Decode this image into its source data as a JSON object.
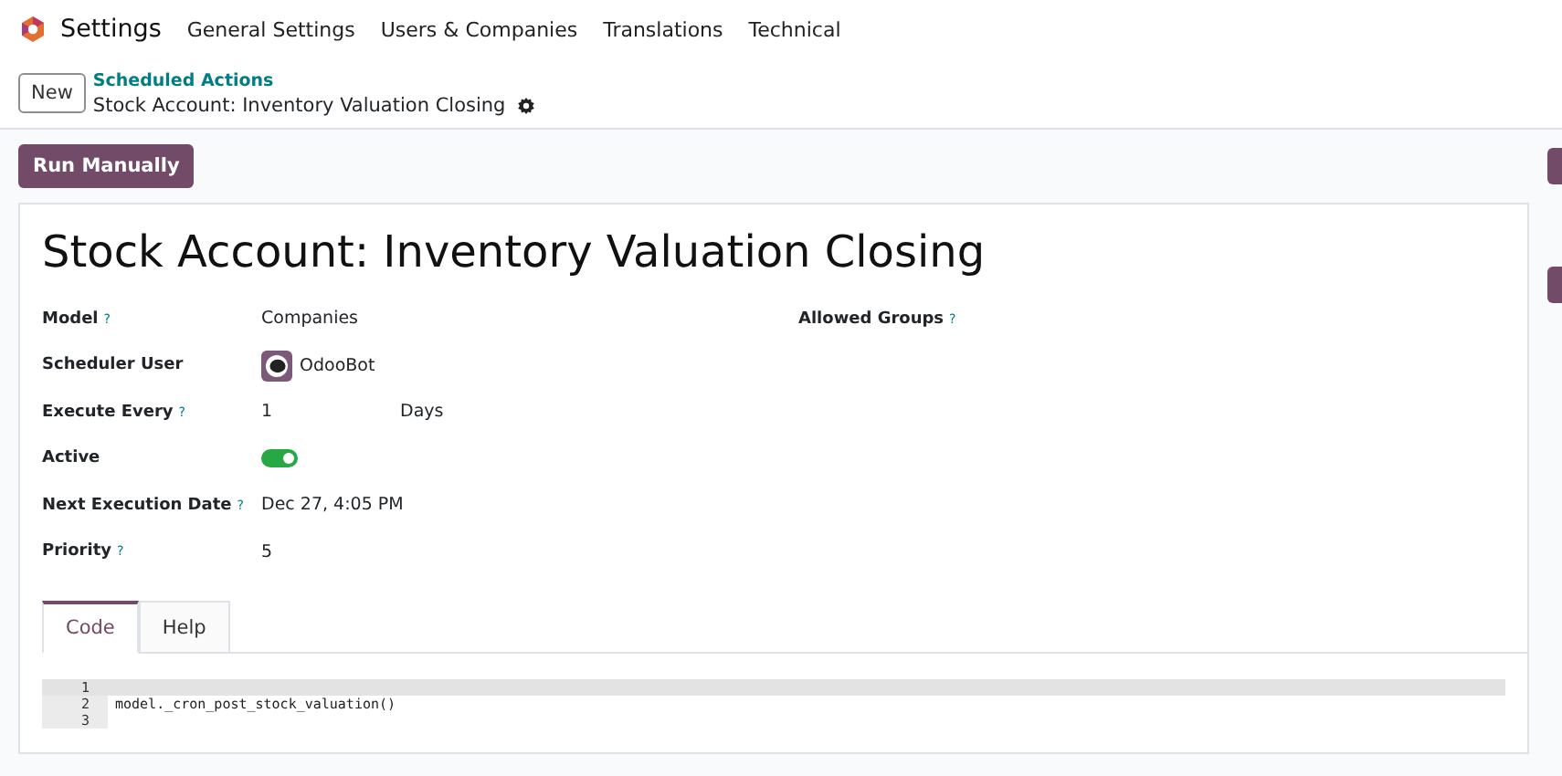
{
  "navbar": {
    "app_name": "Settings",
    "menus": [
      "General Settings",
      "Users & Companies",
      "Translations",
      "Technical"
    ]
  },
  "control_panel": {
    "new_button": "New",
    "breadcrumb": "Scheduled Actions",
    "record_title": "Stock Account: Inventory Valuation Closing"
  },
  "action_button": "Run Manually",
  "form": {
    "title": "Stock Account: Inventory Valuation Closing",
    "left_fields": [
      {
        "kind": "text",
        "label": "Model",
        "help": "?",
        "value": "Companies"
      },
      {
        "kind": "user",
        "label": "Scheduler User",
        "value": "OdooBot"
      },
      {
        "kind": "interval",
        "label": "Execute Every",
        "help": "?",
        "value": "1",
        "unit": "Days"
      },
      {
        "kind": "toggle",
        "label": "Active",
        "on": true
      },
      {
        "kind": "text",
        "label": "Next Execution Date",
        "help": "?",
        "value": "Dec 27, 4:05 PM"
      },
      {
        "kind": "text",
        "label": "Priority",
        "help": "?",
        "value": "5"
      }
    ],
    "right_fields": [
      {
        "label": "Allowed Groups",
        "help": "?"
      }
    ],
    "tabs": [
      {
        "label": "Code",
        "selected": true
      },
      {
        "label": "Help",
        "selected": false
      }
    ],
    "code_lines": [
      {
        "number": "1",
        "selected": true
      },
      {
        "number": "2",
        "text": "model._cron_post_stock_valuation()",
        "selected": false
      },
      {
        "number": "3",
        "selected": false
      }
    ]
  }
}
